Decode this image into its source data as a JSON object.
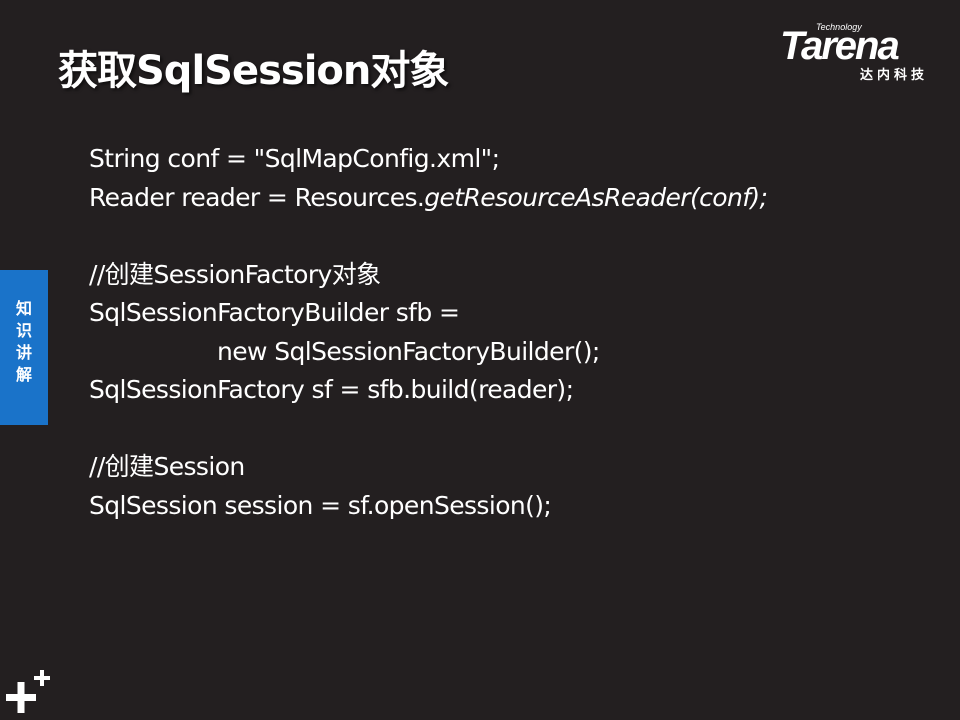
{
  "slide": {
    "title": "获取SqlSession对象"
  },
  "logo": {
    "tech": "Technology",
    "word": "Tarena",
    "cn": "达内科技"
  },
  "side_tab": {
    "chars": [
      "知",
      "识",
      "讲",
      "解"
    ]
  },
  "code": {
    "line1": "String conf = \"SqlMapConfig.xml\";",
    "line2_plain": "Reader reader = Resources.",
    "line2_italic": "getResourceAsReader(conf);",
    "comment1": "//创建SessionFactory对象",
    "line3": "SqlSessionFactoryBuilder sfb =",
    "line4": "new SqlSessionFactoryBuilder();",
    "line5": "SqlSessionFactory sf = sfb.build(reader);",
    "comment2": "//创建Session",
    "line6": "SqlSession session = sf.openSession();"
  },
  "colors": {
    "background": "#231f20",
    "tab": "#1a73c9",
    "text": "#ffffff"
  },
  "icons": {
    "bottom_left": "plus-icon"
  }
}
